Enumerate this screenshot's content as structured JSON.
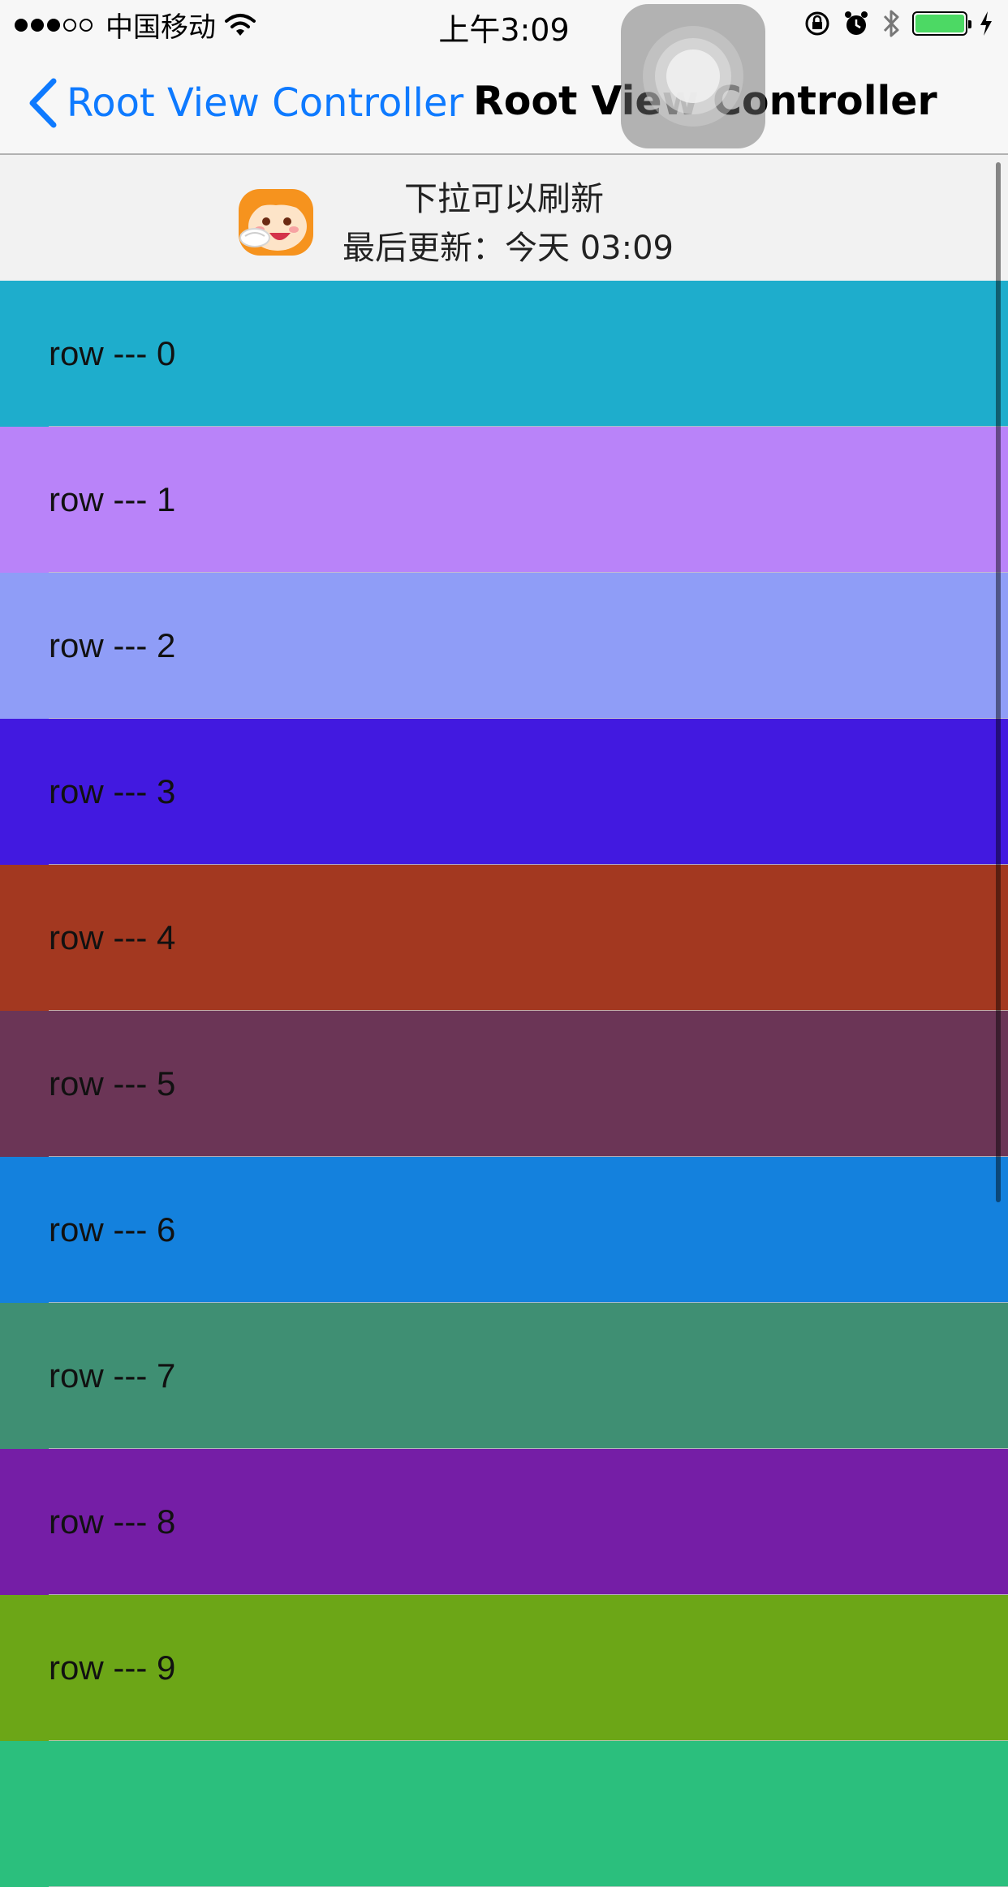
{
  "status_bar": {
    "carrier": "中国移动",
    "time": "上午3:09",
    "battery_color": "#4cd964"
  },
  "nav": {
    "back_label": "Root View Controller",
    "title": "Root View Controller",
    "accent": "#0e7aff"
  },
  "refresh_header": {
    "title": "下拉可以刷新",
    "last_updated": "最后更新：今天 03:09"
  },
  "rows": [
    {
      "label": "row --- 0",
      "color": "#1eadcc"
    },
    {
      "label": "row --- 1",
      "color": "#b983f9"
    },
    {
      "label": "row --- 2",
      "color": "#8f9df7"
    },
    {
      "label": "row --- 3",
      "color": "#4219e0"
    },
    {
      "label": "row --- 4",
      "color": "#a33820"
    },
    {
      "label": "row --- 5",
      "color": "#6b3556"
    },
    {
      "label": "row --- 6",
      "color": "#1481dd"
    },
    {
      "label": "row --- 7",
      "color": "#3f8f73"
    },
    {
      "label": "row --- 8",
      "color": "#751ea6"
    },
    {
      "label": "row --- 9",
      "color": "#6ca617"
    },
    {
      "label": "",
      "color": "#2bbf7d"
    }
  ]
}
